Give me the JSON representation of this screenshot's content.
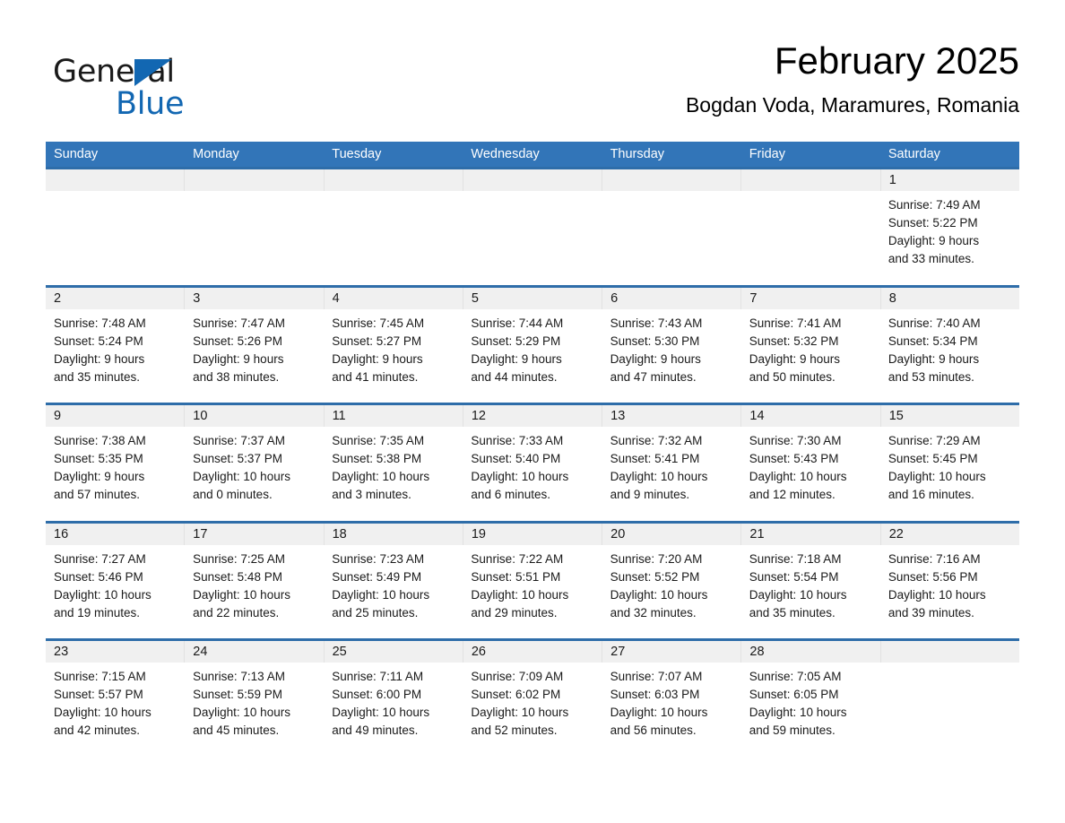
{
  "brand": {
    "name_part1": "General",
    "name_part2": "Blue",
    "accent_color": "#1267b2"
  },
  "header": {
    "title": "February 2025",
    "subtitle": "Bogdan Voda, Maramures, Romania"
  },
  "theme": {
    "header_bg": "#3275b8",
    "row_divider": "#2e6da9",
    "daynum_bg": "#f0f0f0"
  },
  "weekdays": [
    "Sunday",
    "Monday",
    "Tuesday",
    "Wednesday",
    "Thursday",
    "Friday",
    "Saturday"
  ],
  "weeks": [
    {
      "days": [
        {
          "num": "",
          "sunrise": "",
          "sunset": "",
          "daylight_1": "",
          "daylight_2": "",
          "empty": true
        },
        {
          "num": "",
          "sunrise": "",
          "sunset": "",
          "daylight_1": "",
          "daylight_2": "",
          "empty": true
        },
        {
          "num": "",
          "sunrise": "",
          "sunset": "",
          "daylight_1": "",
          "daylight_2": "",
          "empty": true
        },
        {
          "num": "",
          "sunrise": "",
          "sunset": "",
          "daylight_1": "",
          "daylight_2": "",
          "empty": true
        },
        {
          "num": "",
          "sunrise": "",
          "sunset": "",
          "daylight_1": "",
          "daylight_2": "",
          "empty": true
        },
        {
          "num": "",
          "sunrise": "",
          "sunset": "",
          "daylight_1": "",
          "daylight_2": "",
          "empty": true
        },
        {
          "num": "1",
          "sunrise": "Sunrise: 7:49 AM",
          "sunset": "Sunset: 5:22 PM",
          "daylight_1": "Daylight: 9 hours",
          "daylight_2": "and 33 minutes.",
          "empty": false
        }
      ]
    },
    {
      "days": [
        {
          "num": "2",
          "sunrise": "Sunrise: 7:48 AM",
          "sunset": "Sunset: 5:24 PM",
          "daylight_1": "Daylight: 9 hours",
          "daylight_2": "and 35 minutes.",
          "empty": false
        },
        {
          "num": "3",
          "sunrise": "Sunrise: 7:47 AM",
          "sunset": "Sunset: 5:26 PM",
          "daylight_1": "Daylight: 9 hours",
          "daylight_2": "and 38 minutes.",
          "empty": false
        },
        {
          "num": "4",
          "sunrise": "Sunrise: 7:45 AM",
          "sunset": "Sunset: 5:27 PM",
          "daylight_1": "Daylight: 9 hours",
          "daylight_2": "and 41 minutes.",
          "empty": false
        },
        {
          "num": "5",
          "sunrise": "Sunrise: 7:44 AM",
          "sunset": "Sunset: 5:29 PM",
          "daylight_1": "Daylight: 9 hours",
          "daylight_2": "and 44 minutes.",
          "empty": false
        },
        {
          "num": "6",
          "sunrise": "Sunrise: 7:43 AM",
          "sunset": "Sunset: 5:30 PM",
          "daylight_1": "Daylight: 9 hours",
          "daylight_2": "and 47 minutes.",
          "empty": false
        },
        {
          "num": "7",
          "sunrise": "Sunrise: 7:41 AM",
          "sunset": "Sunset: 5:32 PM",
          "daylight_1": "Daylight: 9 hours",
          "daylight_2": "and 50 minutes.",
          "empty": false
        },
        {
          "num": "8",
          "sunrise": "Sunrise: 7:40 AM",
          "sunset": "Sunset: 5:34 PM",
          "daylight_1": "Daylight: 9 hours",
          "daylight_2": "and 53 minutes.",
          "empty": false
        }
      ]
    },
    {
      "days": [
        {
          "num": "9",
          "sunrise": "Sunrise: 7:38 AM",
          "sunset": "Sunset: 5:35 PM",
          "daylight_1": "Daylight: 9 hours",
          "daylight_2": "and 57 minutes.",
          "empty": false
        },
        {
          "num": "10",
          "sunrise": "Sunrise: 7:37 AM",
          "sunset": "Sunset: 5:37 PM",
          "daylight_1": "Daylight: 10 hours",
          "daylight_2": "and 0 minutes.",
          "empty": false
        },
        {
          "num": "11",
          "sunrise": "Sunrise: 7:35 AM",
          "sunset": "Sunset: 5:38 PM",
          "daylight_1": "Daylight: 10 hours",
          "daylight_2": "and 3 minutes.",
          "empty": false
        },
        {
          "num": "12",
          "sunrise": "Sunrise: 7:33 AM",
          "sunset": "Sunset: 5:40 PM",
          "daylight_1": "Daylight: 10 hours",
          "daylight_2": "and 6 minutes.",
          "empty": false
        },
        {
          "num": "13",
          "sunrise": "Sunrise: 7:32 AM",
          "sunset": "Sunset: 5:41 PM",
          "daylight_1": "Daylight: 10 hours",
          "daylight_2": "and 9 minutes.",
          "empty": false
        },
        {
          "num": "14",
          "sunrise": "Sunrise: 7:30 AM",
          "sunset": "Sunset: 5:43 PM",
          "daylight_1": "Daylight: 10 hours",
          "daylight_2": "and 12 minutes.",
          "empty": false
        },
        {
          "num": "15",
          "sunrise": "Sunrise: 7:29 AM",
          "sunset": "Sunset: 5:45 PM",
          "daylight_1": "Daylight: 10 hours",
          "daylight_2": "and 16 minutes.",
          "empty": false
        }
      ]
    },
    {
      "days": [
        {
          "num": "16",
          "sunrise": "Sunrise: 7:27 AM",
          "sunset": "Sunset: 5:46 PM",
          "daylight_1": "Daylight: 10 hours",
          "daylight_2": "and 19 minutes.",
          "empty": false
        },
        {
          "num": "17",
          "sunrise": "Sunrise: 7:25 AM",
          "sunset": "Sunset: 5:48 PM",
          "daylight_1": "Daylight: 10 hours",
          "daylight_2": "and 22 minutes.",
          "empty": false
        },
        {
          "num": "18",
          "sunrise": "Sunrise: 7:23 AM",
          "sunset": "Sunset: 5:49 PM",
          "daylight_1": "Daylight: 10 hours",
          "daylight_2": "and 25 minutes.",
          "empty": false
        },
        {
          "num": "19",
          "sunrise": "Sunrise: 7:22 AM",
          "sunset": "Sunset: 5:51 PM",
          "daylight_1": "Daylight: 10 hours",
          "daylight_2": "and 29 minutes.",
          "empty": false
        },
        {
          "num": "20",
          "sunrise": "Sunrise: 7:20 AM",
          "sunset": "Sunset: 5:52 PM",
          "daylight_1": "Daylight: 10 hours",
          "daylight_2": "and 32 minutes.",
          "empty": false
        },
        {
          "num": "21",
          "sunrise": "Sunrise: 7:18 AM",
          "sunset": "Sunset: 5:54 PM",
          "daylight_1": "Daylight: 10 hours",
          "daylight_2": "and 35 minutes.",
          "empty": false
        },
        {
          "num": "22",
          "sunrise": "Sunrise: 7:16 AM",
          "sunset": "Sunset: 5:56 PM",
          "daylight_1": "Daylight: 10 hours",
          "daylight_2": "and 39 minutes.",
          "empty": false
        }
      ]
    },
    {
      "days": [
        {
          "num": "23",
          "sunrise": "Sunrise: 7:15 AM",
          "sunset": "Sunset: 5:57 PM",
          "daylight_1": "Daylight: 10 hours",
          "daylight_2": "and 42 minutes.",
          "empty": false
        },
        {
          "num": "24",
          "sunrise": "Sunrise: 7:13 AM",
          "sunset": "Sunset: 5:59 PM",
          "daylight_1": "Daylight: 10 hours",
          "daylight_2": "and 45 minutes.",
          "empty": false
        },
        {
          "num": "25",
          "sunrise": "Sunrise: 7:11 AM",
          "sunset": "Sunset: 6:00 PM",
          "daylight_1": "Daylight: 10 hours",
          "daylight_2": "and 49 minutes.",
          "empty": false
        },
        {
          "num": "26",
          "sunrise": "Sunrise: 7:09 AM",
          "sunset": "Sunset: 6:02 PM",
          "daylight_1": "Daylight: 10 hours",
          "daylight_2": "and 52 minutes.",
          "empty": false
        },
        {
          "num": "27",
          "sunrise": "Sunrise: 7:07 AM",
          "sunset": "Sunset: 6:03 PM",
          "daylight_1": "Daylight: 10 hours",
          "daylight_2": "and 56 minutes.",
          "empty": false
        },
        {
          "num": "28",
          "sunrise": "Sunrise: 7:05 AM",
          "sunset": "Sunset: 6:05 PM",
          "daylight_1": "Daylight: 10 hours",
          "daylight_2": "and 59 minutes.",
          "empty": false
        },
        {
          "num": "",
          "sunrise": "",
          "sunset": "",
          "daylight_1": "",
          "daylight_2": "",
          "empty": true
        }
      ]
    }
  ]
}
